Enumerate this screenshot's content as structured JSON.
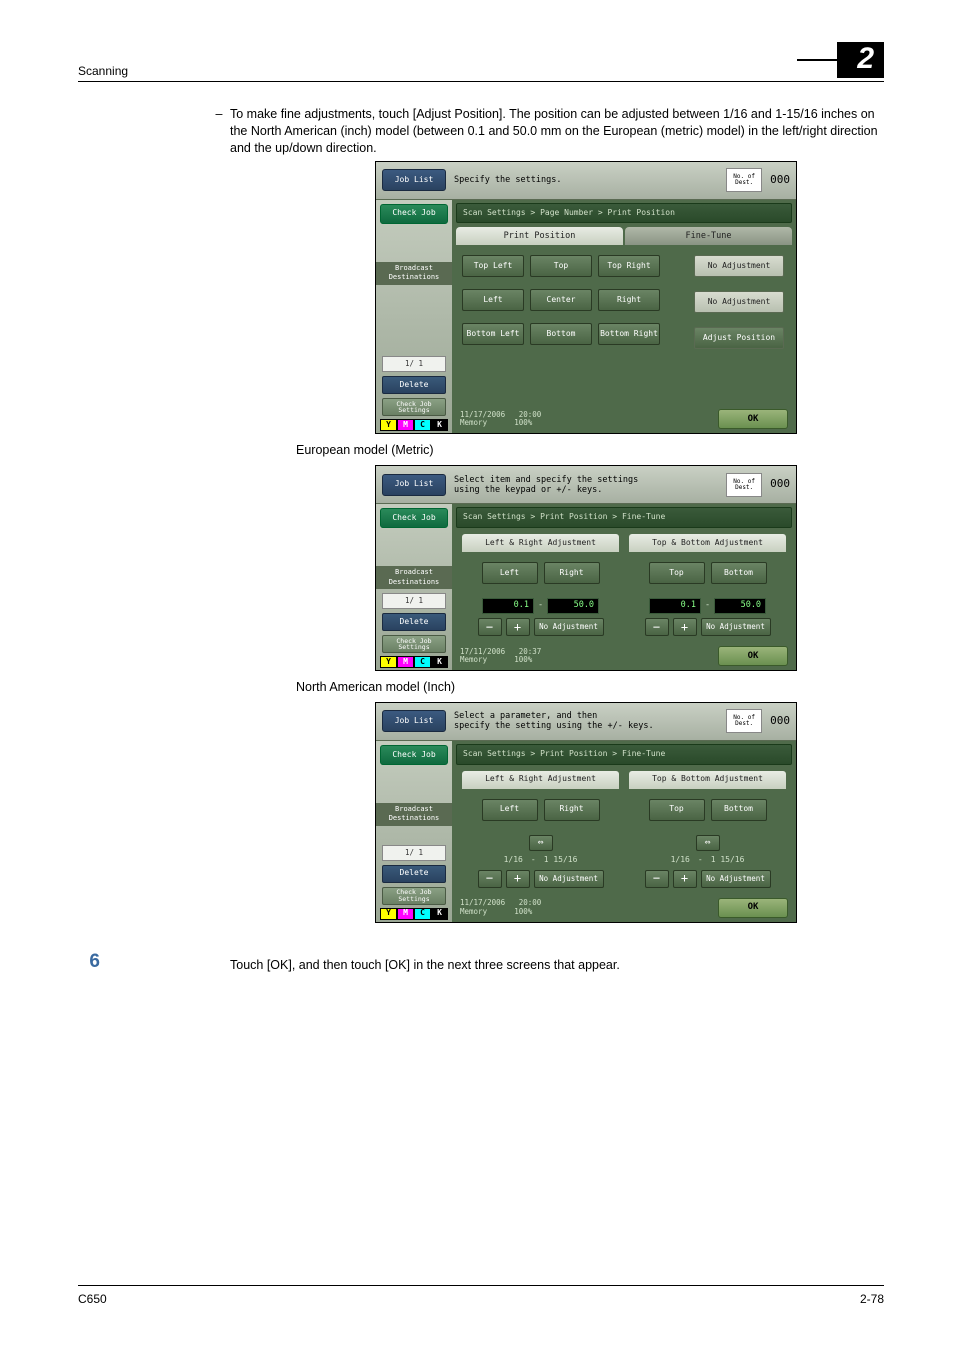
{
  "header": {
    "left": "Scanning",
    "chapter": "2"
  },
  "intro": {
    "dash": "–",
    "text": "To make fine adjustments, touch [Adjust Position]. The position can be adjusted between 1/16 and 1-15/16 inches on the North American (inch) model (between 0.1 and 50.0 mm on the European (metric) model) in the left/right direction and the up/down direction."
  },
  "captions": {
    "euro": "European model (Metric)",
    "na": "North American model (Inch)"
  },
  "common": {
    "job_list": "Job List",
    "check_job": "Check Job",
    "broadcast": "Broadcast\nDestinations",
    "page_ind": "1/  1",
    "delete": "Delete",
    "check_settings": "Check Job\nSettings",
    "toner": {
      "y": "Y",
      "m": "M",
      "c": "C",
      "k": "K"
    },
    "dest_label": "No. of\nDest.",
    "dest_count": "000",
    "ok": "OK"
  },
  "screen1": {
    "title": "Specify the settings.",
    "crumb": "Scan Settings > Page Number > Print Position",
    "tabs": {
      "a": "Print Position",
      "b": "Fine-Tune"
    },
    "grid": {
      "r1": [
        "Top Left",
        "Top",
        "Top Right"
      ],
      "r2": [
        "Left",
        "Center",
        "Right"
      ],
      "r3": [
        "Bottom Left",
        "Bottom",
        "Bottom Right"
      ]
    },
    "right": {
      "noadj": "No Adjustment",
      "adjust": "Adjust Position"
    },
    "stamp": {
      "date": "11/17/2006",
      "time": "20:00",
      "mem": "Memory",
      "pct": "100%"
    }
  },
  "screen2": {
    "title": "Select item and specify the settings\nusing the keypad or +/- keys.",
    "crumb": "Scan Settings > Print Position > Fine-Tune",
    "heads": {
      "lr": "Left & Right Adjustment",
      "tb": "Top & Bottom Adjustment"
    },
    "btns": {
      "left": "Left",
      "right": "Right",
      "top": "Top",
      "bottom": "Bottom"
    },
    "range": {
      "lo": "0.1",
      "sep": "-",
      "hi": "50.0"
    },
    "noadj": "No Adjustment",
    "stamp": {
      "date": "17/11/2006",
      "time": "20:37",
      "mem": "Memory",
      "pct": "100%"
    }
  },
  "screen3": {
    "title": "Select a parameter, and then\nspecify the setting using the +/- keys.",
    "crumb": "Scan Settings > Print Position > Fine-Tune",
    "heads": {
      "lr": "Left & Right Adjustment",
      "tb": "Top & Bottom Adjustment"
    },
    "btns": {
      "left": "Left",
      "right": "Right",
      "top": "Top",
      "bottom": "Bottom"
    },
    "range": {
      "lo": "1/16",
      "sep": "-",
      "hi": "1 15/16"
    },
    "swap": "⇔",
    "noadj": "No Adjustment",
    "stamp": {
      "date": "11/17/2006",
      "time": "20:00",
      "mem": "Memory",
      "pct": "100%"
    }
  },
  "step6": {
    "num": "6",
    "text": "Touch [OK], and then touch [OK] in the next three screens that appear."
  },
  "footer": {
    "left": "C650",
    "right": "2-78"
  }
}
